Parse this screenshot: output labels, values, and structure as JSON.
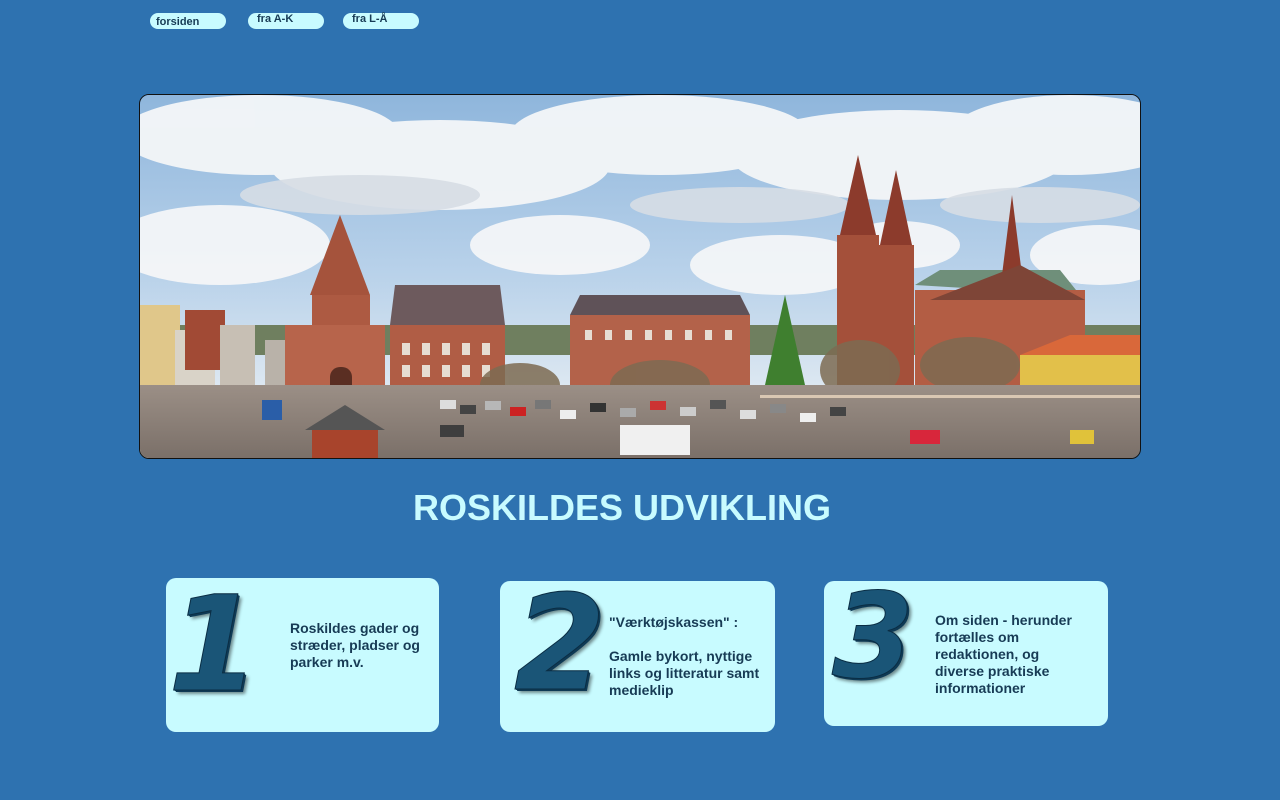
{
  "nav": {
    "items": [
      {
        "label": "forsiden"
      },
      {
        "label": "fra A-K"
      },
      {
        "label": "fra L-Å"
      }
    ]
  },
  "hero": {
    "image": "panorama-roskilde-cathedral-town-square"
  },
  "title": "ROSKILDES UDVIKLING",
  "cards": [
    {
      "number": "1",
      "text": "Roskildes gader og stræder, pladser og parker m.v."
    },
    {
      "number": "2",
      "text": "\"Værktøjskassen\" :\n\nGamle bykort, nyttige links og litteratur samt medieklip"
    },
    {
      "number": "3",
      "text": "Om siden - herunder fortælles om redaktionen, og diverse praktiske informationer"
    }
  ],
  "colors": {
    "background": "#2e72b0",
    "accent": "#c8fbff",
    "text_dark": "#173b55"
  }
}
